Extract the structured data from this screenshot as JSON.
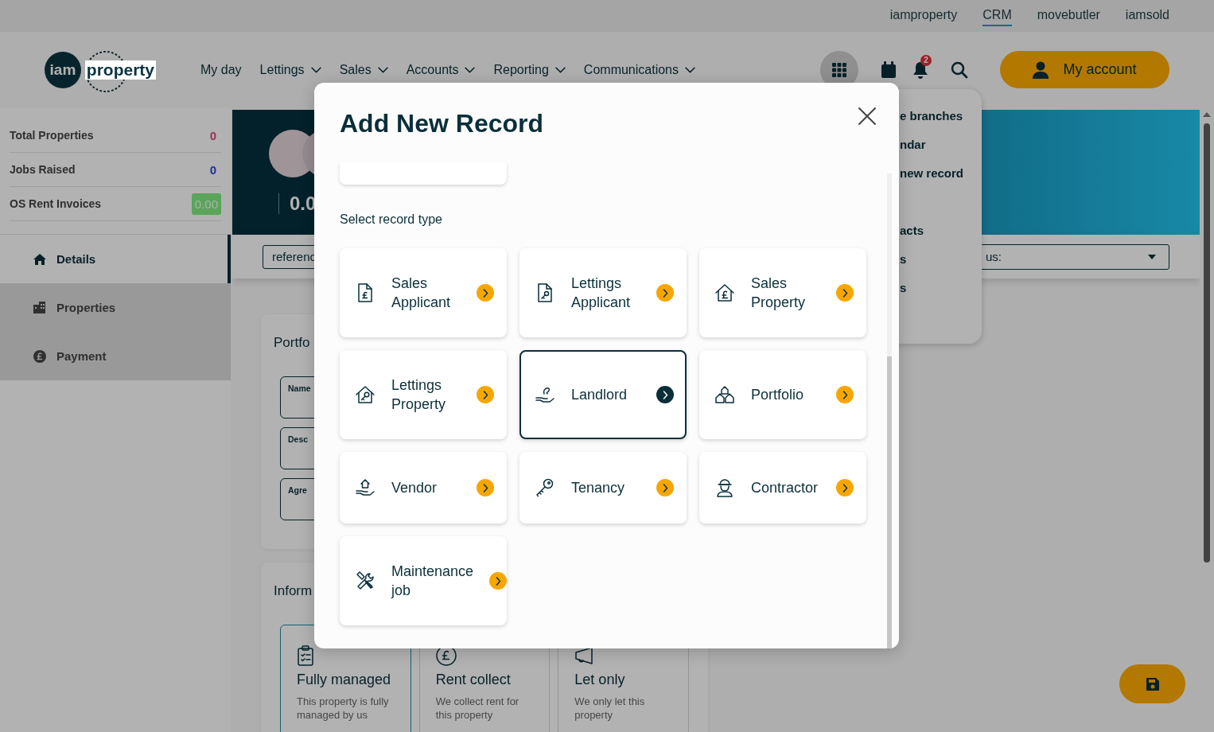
{
  "top_links": [
    {
      "label": "iamproperty",
      "selected": false
    },
    {
      "label": "CRM",
      "selected": true
    },
    {
      "label": "movebutler",
      "selected": false
    },
    {
      "label": "iamsold",
      "selected": false
    }
  ],
  "logo": {
    "mark": "iam",
    "text": "property"
  },
  "nav": [
    {
      "label": "My day",
      "dropdown": false
    },
    {
      "label": "Lettings",
      "dropdown": true
    },
    {
      "label": "Sales",
      "dropdown": true
    },
    {
      "label": "Accounts",
      "dropdown": true
    },
    {
      "label": "Reporting",
      "dropdown": true
    },
    {
      "label": "Communications",
      "dropdown": true
    }
  ],
  "header_actions": {
    "notification_count": "2",
    "account_button": "My account"
  },
  "apps_menu": {
    "items": [
      "e branches",
      "ndar",
      "new record",
      "acts",
      "s",
      "s"
    ]
  },
  "stats": [
    {
      "label": "Total Properties",
      "value": "0",
      "kind": "count"
    },
    {
      "label": "Jobs Raised",
      "value": "0",
      "kind": "count"
    },
    {
      "label": "OS Rent Invoices",
      "value": "0.00",
      "kind": "badge"
    }
  ],
  "sidebar_nav": [
    {
      "label": "Details",
      "selected": true
    },
    {
      "label": "Properties",
      "selected": false
    },
    {
      "label": "Payment",
      "selected": false
    }
  ],
  "banner": {
    "amount": "0.0"
  },
  "filters": {
    "reference_field": "referenc",
    "status_select": "us:"
  },
  "portfolio_card": {
    "title": "Portfo",
    "fields": [
      "Name",
      "Desc",
      "Agre"
    ]
  },
  "information_card": {
    "title": "Inform",
    "options": [
      {
        "title": "Fully managed",
        "description": "This property is fully managed by us",
        "selected": true
      },
      {
        "title": "Rent collect",
        "description": "We collect rent for this property",
        "selected": false
      },
      {
        "title": "Let only",
        "description": "We only let this property",
        "selected": false
      }
    ]
  },
  "modal": {
    "title": "Add New Record",
    "section_label": "Select record type",
    "record_types": [
      {
        "label": "Sales Applicant",
        "selected": false
      },
      {
        "label": "Lettings Applicant",
        "selected": false
      },
      {
        "label": "Sales Property",
        "selected": false
      },
      {
        "label": "Lettings Property",
        "selected": false
      },
      {
        "label": "Landlord",
        "selected": true
      },
      {
        "label": "Portfolio",
        "selected": false
      },
      {
        "label": "Vendor",
        "selected": false
      },
      {
        "label": "Tenancy",
        "selected": false
      },
      {
        "label": "Contractor",
        "selected": false
      },
      {
        "label": "Maintenance job",
        "selected": false
      }
    ]
  }
}
